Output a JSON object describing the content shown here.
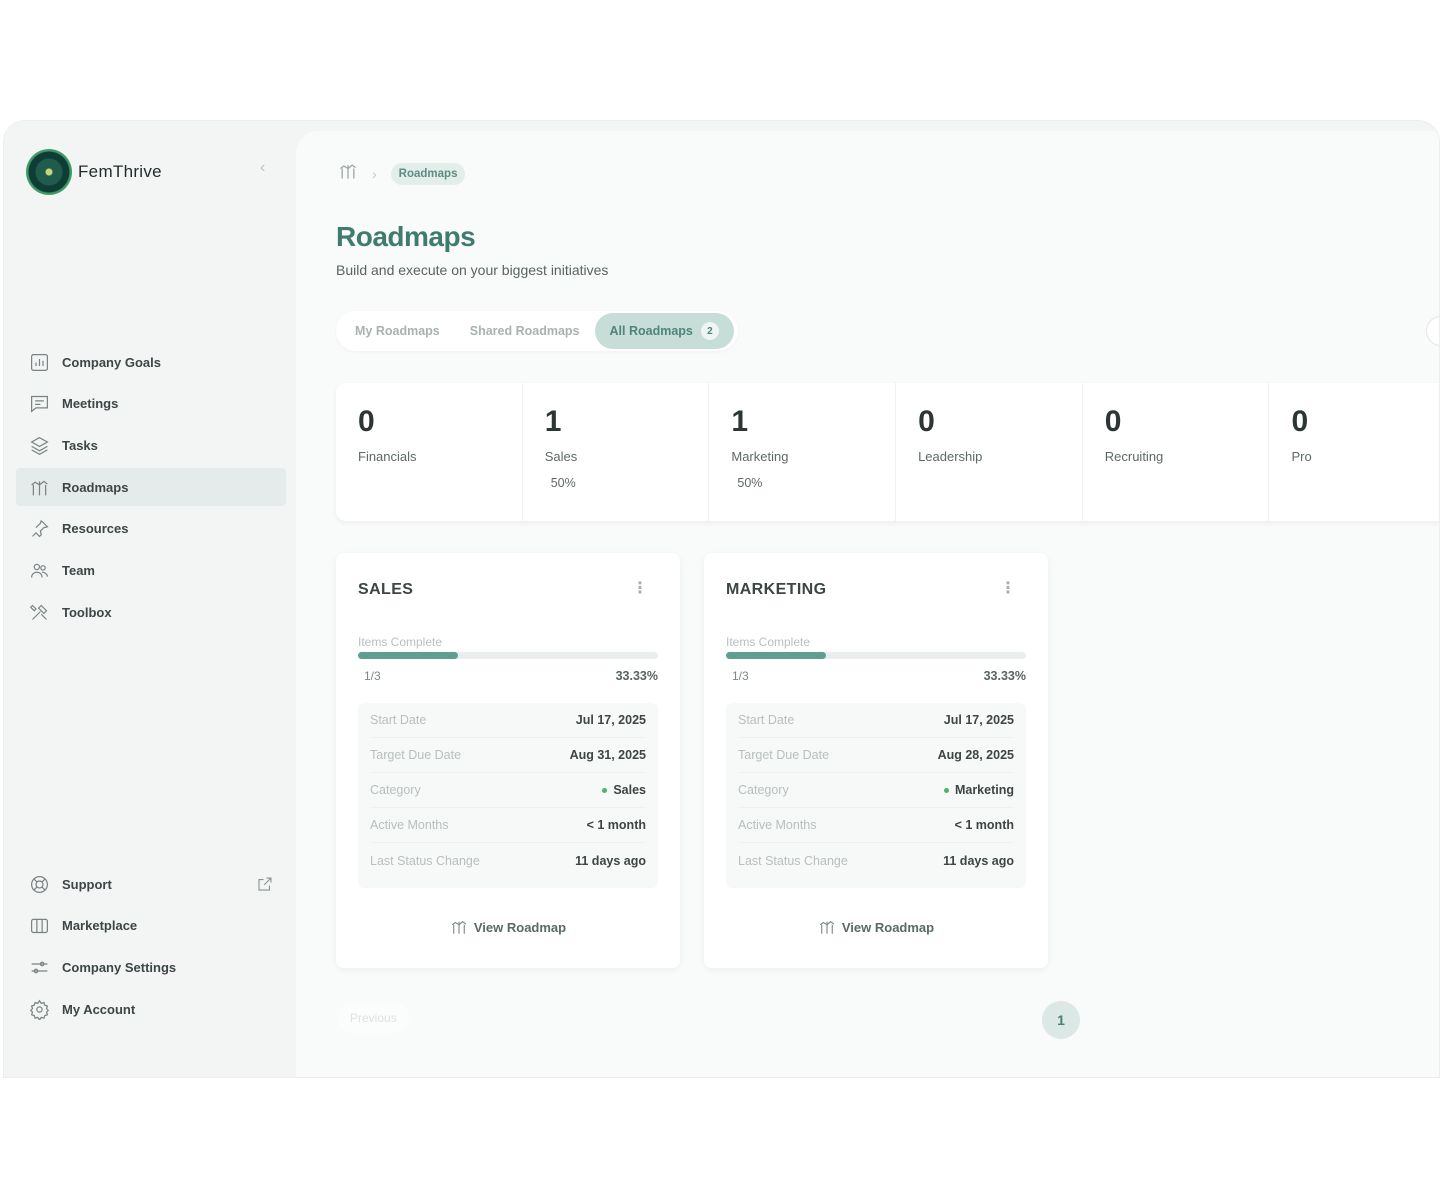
{
  "brand": {
    "name": "FemThrive"
  },
  "sidebar": {
    "items": [
      {
        "label": "Company Goals",
        "icon": "chart-icon"
      },
      {
        "label": "Meetings",
        "icon": "chat-icon"
      },
      {
        "label": "Tasks",
        "icon": "layers-icon"
      },
      {
        "label": "Roadmaps",
        "icon": "roadmap-icon",
        "active": true
      },
      {
        "label": "Resources",
        "icon": "pin-icon"
      },
      {
        "label": "Team",
        "icon": "team-icon"
      },
      {
        "label": "Toolbox",
        "icon": "tools-icon"
      }
    ],
    "bottom": [
      {
        "label": "Support",
        "icon": "lifebuoy-icon"
      },
      {
        "label": "Marketplace",
        "icon": "store-icon"
      },
      {
        "label": "Company Settings",
        "icon": "sliders-icon"
      },
      {
        "label": "My Account",
        "icon": "gear-icon"
      }
    ]
  },
  "breadcrumb": {
    "current": "Roadmaps"
  },
  "page": {
    "title": "Roadmaps",
    "subtitle": "Build and execute on your biggest initiatives"
  },
  "tabs": [
    {
      "label": "My Roadmaps"
    },
    {
      "label": "Shared Roadmaps"
    },
    {
      "label": "All Roadmaps",
      "badge": "2",
      "active": true
    }
  ],
  "stats": [
    {
      "num": "0",
      "label": "Financials",
      "pct": ""
    },
    {
      "num": "1",
      "label": "Sales",
      "pct": "50%"
    },
    {
      "num": "1",
      "label": "Marketing",
      "pct": "50%"
    },
    {
      "num": "0",
      "label": "Leadership",
      "pct": ""
    },
    {
      "num": "0",
      "label": "Recruiting",
      "pct": ""
    },
    {
      "num": "0",
      "label": "Pro",
      "pct": ""
    }
  ],
  "cards": [
    {
      "title": "SALES",
      "items_label": "Items Complete",
      "progress": 0.3333,
      "fraction": "1/3",
      "percent": "33.33%",
      "rows": [
        {
          "k": "Start Date",
          "v": "Jul 17, 2025"
        },
        {
          "k": "Target Due Date",
          "v": "Aug 31, 2025"
        },
        {
          "k": "Category",
          "v": "Sales"
        },
        {
          "k": "Active Months",
          "v": "< 1 month"
        },
        {
          "k": "Last Status Change",
          "v": "11 days ago"
        }
      ],
      "view_label": "View Roadmap"
    },
    {
      "title": "MARKETING",
      "items_label": "Items Complete",
      "progress": 0.3333,
      "fraction": "1/3",
      "percent": "33.33%",
      "rows": [
        {
          "k": "Start Date",
          "v": "Jul 17, 2025"
        },
        {
          "k": "Target Due Date",
          "v": "Aug 28, 2025"
        },
        {
          "k": "Category",
          "v": "Marketing"
        },
        {
          "k": "Active Months",
          "v": "< 1 month"
        },
        {
          "k": "Last Status Change",
          "v": "11 days ago"
        }
      ],
      "view_label": "View Roadmap"
    }
  ],
  "pager": {
    "prev": "Previous",
    "current": "1"
  },
  "colors": {
    "accent": "#3f7b6e",
    "progress": "#5e9f91",
    "active_bg": "#e4ebea",
    "category_dot": "#4db36b"
  }
}
